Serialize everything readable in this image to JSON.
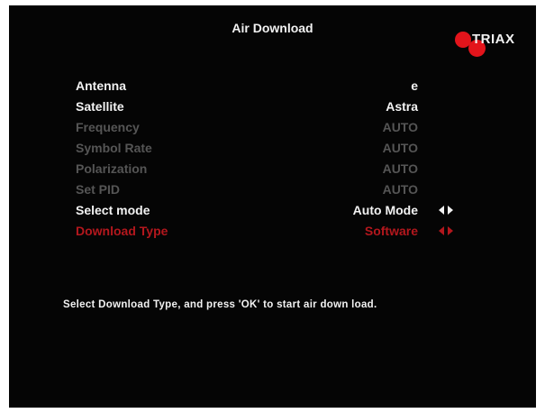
{
  "screen": {
    "title": "Air Download",
    "brand": "TRIAX",
    "hint": "Select Download Type, and press 'OK' to start air down load."
  },
  "colors": {
    "background": "#050505",
    "text": "#f2f2f2",
    "disabled": "#555555",
    "selected": "#b3171d",
    "brand_red": "#e3141b"
  },
  "menu": {
    "antenna": {
      "label": "Antenna",
      "value": "e"
    },
    "satellite": {
      "label": "Satellite",
      "value": "Astra"
    },
    "frequency": {
      "label": "Frequency",
      "value": "AUTO"
    },
    "symbol_rate": {
      "label": "Symbol Rate",
      "value": "AUTO"
    },
    "polarization": {
      "label": "Polarization",
      "value": "AUTO"
    },
    "set_pid": {
      "label": "Set PID",
      "value": "AUTO"
    },
    "select_mode": {
      "label": "Select mode",
      "value": "Auto Mode",
      "icon": "left-right-arrows-icon"
    },
    "download_type": {
      "label": "Download Type",
      "value": "Software",
      "icon": "left-right-arrows-icon",
      "selected": true
    }
  }
}
